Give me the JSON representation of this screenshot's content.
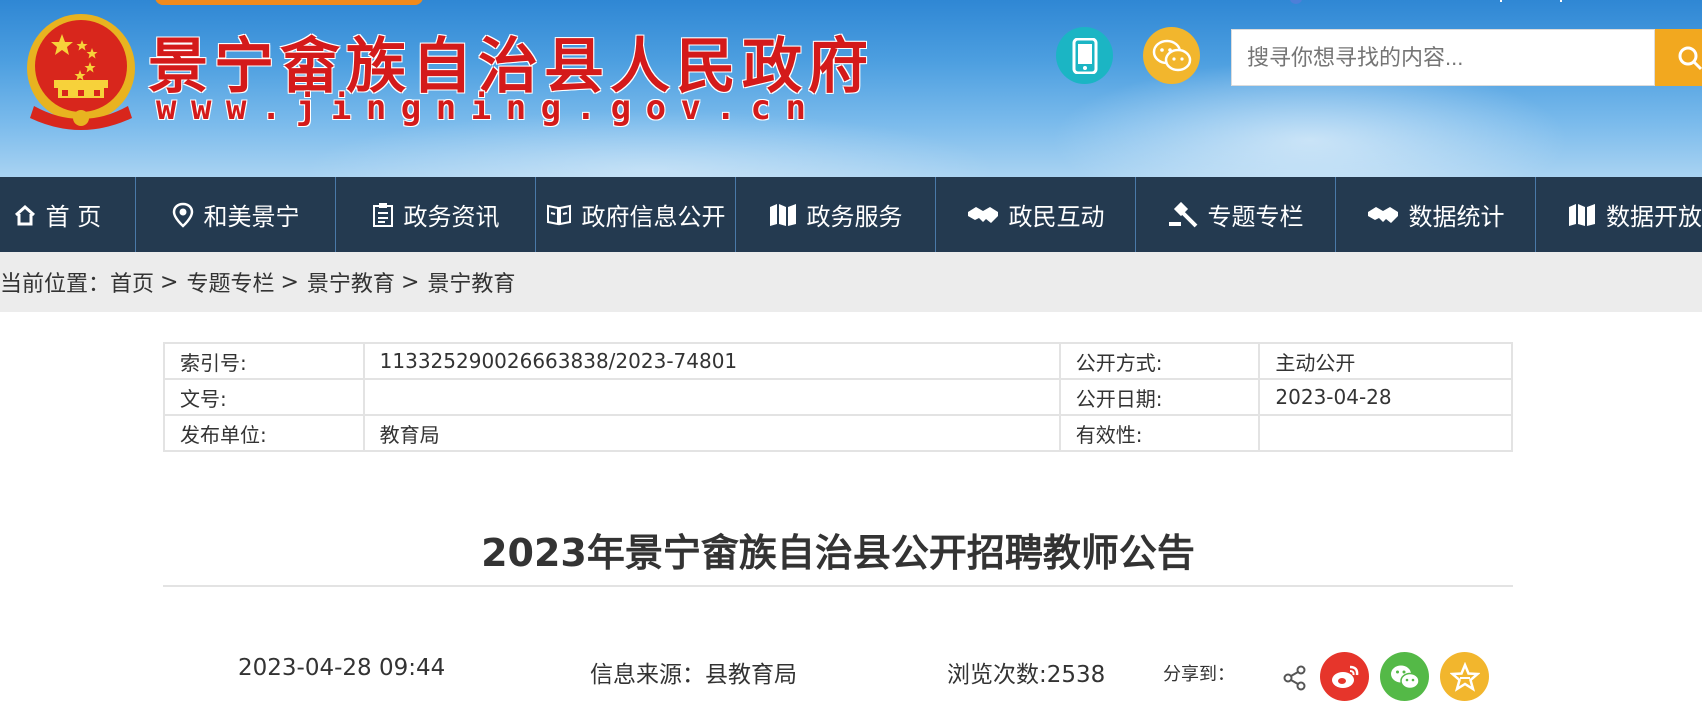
{
  "header": {
    "site_title": "景宁畲族自治县人民政府",
    "site_url": "www.jingning.gov.cn",
    "search_placeholder": "搜寻你想寻找的内容..."
  },
  "nav": {
    "items": [
      {
        "label": "首 页",
        "icon": "home-icon"
      },
      {
        "label": "和美景宁",
        "icon": "location-pin-icon"
      },
      {
        "label": "政务资讯",
        "icon": "clipboard-icon"
      },
      {
        "label": "政府信息公开",
        "icon": "book-icon"
      },
      {
        "label": "政务服务",
        "icon": "map-icon"
      },
      {
        "label": "政民互动",
        "icon": "handshake-icon"
      },
      {
        "label": "专题专栏",
        "icon": "gavel-icon"
      },
      {
        "label": "数据统计",
        "icon": "handshake-icon"
      },
      {
        "label": "数据开放",
        "icon": "map-icon"
      }
    ]
  },
  "breadcrumb": {
    "prefix": "当前位置：",
    "items": [
      "首页",
      "专题专栏",
      "景宁教育",
      "景宁教育"
    ]
  },
  "info": {
    "rows": [
      {
        "k1": "索引号:",
        "v1": "113325290026663838/2023-74801",
        "k2": "公开方式:",
        "v2": "主动公开"
      },
      {
        "k1": "文号:",
        "v1": "",
        "k2": "公开日期:",
        "v2": "2023-04-28"
      },
      {
        "k1": "发布单位:",
        "v1": "教育局",
        "k2": "有效性:",
        "v2": ""
      }
    ]
  },
  "article": {
    "title": "2023年景宁畲族自治县公开招聘教师公告",
    "datetime": "2023-04-28 09:44",
    "source": "信息来源：县教育局",
    "views": "浏览次数:2538",
    "share_label": "分享到："
  },
  "colors": {
    "nav_bg": "#243a50",
    "title_red": "#d41a1a",
    "search_btn": "#f2a81f",
    "weibo": "#e6352b",
    "wechat": "#54b947",
    "favorite": "#f2b62d"
  }
}
